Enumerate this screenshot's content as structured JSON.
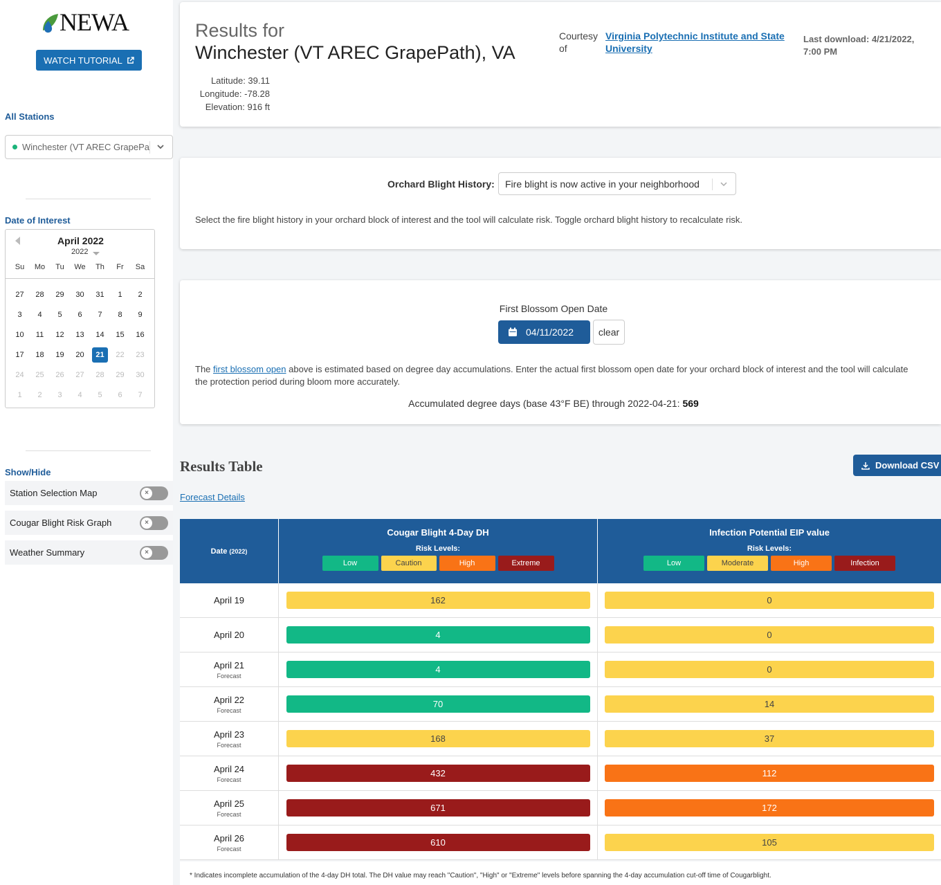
{
  "sidebar": {
    "logo_text": "NEWA",
    "tutorial_label": "WATCH TUTORIAL",
    "all_stations_label": "All Stations",
    "station_value": "Winchester (VT AREC GrapePath)",
    "date_of_interest_label": "Date of Interest",
    "calendar": {
      "month_title": "April 2022",
      "year": "2022",
      "weekdays": [
        "Su",
        "Mo",
        "Tu",
        "We",
        "Th",
        "Fr",
        "Sa"
      ],
      "weeks": [
        [
          "27",
          "28",
          "29",
          "30",
          "31",
          "1",
          "2"
        ],
        [
          "3",
          "4",
          "5",
          "6",
          "7",
          "8",
          "9"
        ],
        [
          "10",
          "11",
          "12",
          "13",
          "14",
          "15",
          "16"
        ],
        [
          "17",
          "18",
          "19",
          "20",
          "21",
          "22",
          "23"
        ],
        [
          "24",
          "25",
          "26",
          "27",
          "28",
          "29",
          "30"
        ],
        [
          "1",
          "2",
          "3",
          "4",
          "5",
          "6",
          "7"
        ]
      ],
      "selected_day": "21"
    },
    "show_hide_label": "Show/Hide",
    "toggles": [
      "Station Selection Map",
      "Cougar Blight Risk Graph",
      "Weather Summary"
    ]
  },
  "header": {
    "results_for": "Results for",
    "location": "Winchester (VT AREC GrapePath), VA",
    "latitude": "Latitude: 39.11",
    "longitude": "Longitude: -78.28",
    "elevation": "Elevation: 916 ft",
    "courtesy_label": "Courtesy of",
    "institution": "Virginia Polytechnic Institute and State University",
    "last_download": "Last download: 4/21/2022, 7:00 PM"
  },
  "history": {
    "label": "Orchard Blight History:",
    "value": "Fire blight is now active in your neighborhood",
    "note": "Select the fire blight history in your orchard block of interest and the tool will calculate risk. Toggle orchard blight history to recalculate risk."
  },
  "blossom": {
    "title": "First Blossom Open Date",
    "date": "04/11/2022",
    "clear_label": "clear",
    "note_prefix": "The ",
    "note_link": "first blossom open",
    "note_suffix": " above is estimated based on degree day accumulations. Enter the actual first blossom open date for your orchard block of interest and the tool will calculate the protection period during bloom more accurately.",
    "accum_text": "Accumulated degree days (base 43°F BE) through 2022-04-21: ",
    "accum_value": "569"
  },
  "results": {
    "title": "Results Table",
    "download_label": "Download CSV",
    "forecast_link": "Forecast Details",
    "date_header": "Date",
    "date_header_year": "(2022)",
    "col1_title": "Cougar Blight 4-Day DH",
    "col2_title": "Infection Potential EIP value",
    "risk_levels_label": "Risk Levels:",
    "col1_levels": [
      {
        "label": "Low",
        "color": "#12b886",
        "text": "#fff"
      },
      {
        "label": "Caution",
        "color": "#fcd34d",
        "text": "#444"
      },
      {
        "label": "High",
        "color": "#f97316",
        "text": "#fff"
      },
      {
        "label": "Extreme",
        "color": "#991b1b",
        "text": "#fff"
      }
    ],
    "col2_levels": [
      {
        "label": "Low",
        "color": "#12b886",
        "text": "#fff"
      },
      {
        "label": "Moderate",
        "color": "#fcd34d",
        "text": "#444"
      },
      {
        "label": "High",
        "color": "#f97316",
        "text": "#fff"
      },
      {
        "label": "Infection",
        "color": "#991b1b",
        "text": "#fff"
      }
    ],
    "rows": [
      {
        "date": "April 19",
        "forecast": "",
        "dh": "162",
        "dh_level": "Caution",
        "eip": "0",
        "eip_level": "Moderate"
      },
      {
        "date": "April 20",
        "forecast": "",
        "dh": "4",
        "dh_level": "Low",
        "eip": "0",
        "eip_level": "Moderate"
      },
      {
        "date": "April 21",
        "forecast": "Forecast",
        "dh": "4",
        "dh_level": "Low",
        "eip": "0",
        "eip_level": "Moderate"
      },
      {
        "date": "April 22",
        "forecast": "Forecast",
        "dh": "70",
        "dh_level": "Low",
        "eip": "14",
        "eip_level": "Moderate"
      },
      {
        "date": "April 23",
        "forecast": "Forecast",
        "dh": "168",
        "dh_level": "Caution",
        "eip": "37",
        "eip_level": "Moderate"
      },
      {
        "date": "April 24",
        "forecast": "Forecast",
        "dh": "432",
        "dh_level": "Extreme",
        "eip": "112",
        "eip_level": "High"
      },
      {
        "date": "April 25",
        "forecast": "Forecast",
        "dh": "671",
        "dh_level": "Extreme",
        "eip": "172",
        "eip_level": "High"
      },
      {
        "date": "April 26",
        "forecast": "Forecast",
        "dh": "610",
        "dh_level": "Extreme",
        "eip": "105",
        "eip_level": "Moderate"
      }
    ],
    "footnote": "* Indicates incomplete accumulation of the 4-day DH total. The DH value may reach \"Caution\", \"High\" or \"Extreme\" levels before spanning the 4-day accumulation cut-off time of Cougarblight."
  }
}
